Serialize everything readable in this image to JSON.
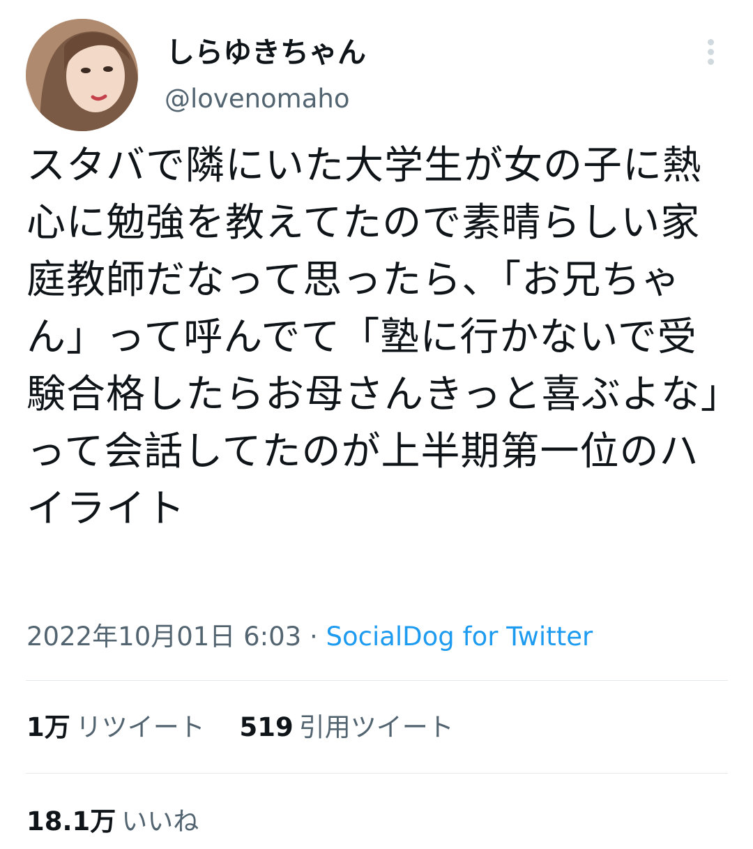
{
  "user": {
    "display_name": "しらゆきちゃん",
    "handle": "@lovenomaho"
  },
  "tweet": {
    "text": "スタバで隣にいた大学生が女の子に熱心に勉強を教えてたので素晴らしい家庭教師だなって思ったら、「お兄ちゃん」って呼んでて「塾に行かないで受験合格したらお母さんきっと喜ぶよな」って会話してたのが上半期第一位のハイライト",
    "timestamp": "2022年10月01日 6:03",
    "separator": "·",
    "source": "SocialDog for Twitter"
  },
  "stats": {
    "retweets": {
      "count": "1万",
      "label": "リツイート"
    },
    "quotes": {
      "count": "519",
      "label": "引用ツイート"
    },
    "likes": {
      "count": "18.1万",
      "label": "いいね"
    }
  },
  "icons": {
    "more": "more-vertical-icon"
  },
  "colors": {
    "text": "#0f1419",
    "secondary": "#536471",
    "link": "#1d9bf0",
    "divider": "#e6e9eb"
  }
}
